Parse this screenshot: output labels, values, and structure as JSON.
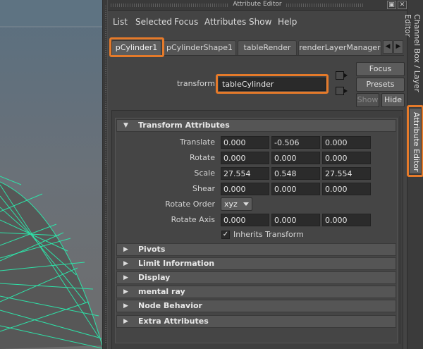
{
  "window": {
    "title": "Attribute Editor",
    "float_icon": "float-window-icon",
    "close_icon": "close-icon"
  },
  "menu": [
    "List",
    "Selected",
    "Focus",
    "Attributes",
    "Show",
    "Help"
  ],
  "tabs": [
    {
      "label": "pCylinder1",
      "active": true
    },
    {
      "label": "pCylinderShape1",
      "active": false
    },
    {
      "label": "tableRender",
      "active": false
    },
    {
      "label": "renderLayerManager",
      "active": false
    }
  ],
  "tab_scroll": {
    "left_icon": "tab-scroll-left-icon",
    "right_icon": "tab-scroll-right-icon"
  },
  "node": {
    "type_label": "transform:",
    "name": "tableCylinder"
  },
  "buttons": {
    "focus": "Focus",
    "presets": "Presets",
    "show": "Show",
    "hide": "Hide"
  },
  "transform_section": {
    "title": "Transform Attributes",
    "rows": [
      {
        "label": "Translate",
        "values": [
          "0.000",
          "-0.506",
          "0.000"
        ]
      },
      {
        "label": "Rotate",
        "values": [
          "0.000",
          "0.000",
          "0.000"
        ]
      },
      {
        "label": "Scale",
        "values": [
          "27.554",
          "0.548",
          "27.554"
        ]
      },
      {
        "label": "Shear",
        "values": [
          "0.000",
          "0.000",
          "0.000"
        ]
      }
    ],
    "rotate_order_label": "Rotate Order",
    "rotate_order_value": "xyz",
    "rotate_axis_label": "Rotate Axis",
    "rotate_axis_values": [
      "0.000",
      "0.000",
      "0.000"
    ],
    "inherits_label": "Inherits Transform",
    "inherits_checked": true
  },
  "collapsed_sections": [
    "Pivots",
    "Limit Information",
    "Display",
    "mental ray",
    "Node Behavior",
    "Extra Attributes"
  ],
  "dock_tabs": {
    "channel_box": "Channel Box / Layer Editor",
    "attribute_editor": "Attribute Editor"
  },
  "colors": {
    "highlight": "#e57a2a",
    "wireframe": "#29e0a3",
    "viewport_bg_top": "#5b6e7d",
    "viewport_bg_bottom": "#6d6d6d"
  }
}
